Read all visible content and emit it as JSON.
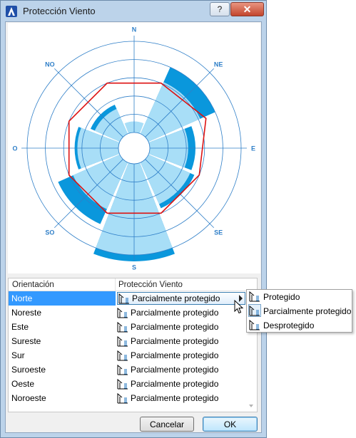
{
  "window": {
    "title": "Protección Viento",
    "help_label": "?",
    "close_label": "✕"
  },
  "rose": {
    "directions": [
      "N",
      "NE",
      "E",
      "SE",
      "S",
      "SO",
      "O",
      "NO"
    ],
    "ring_color": "#2f7fc8",
    "light_color": "#a8def7",
    "dark_color": "#0a97dc",
    "polygon_color": "#dd1111",
    "light_levels": [
      0.12,
      0.62,
      0.42,
      0.5,
      1.0,
      0.56,
      0.45,
      0.3
    ],
    "dark_levels": [
      0.0,
      0.8,
      0.5,
      0.55,
      1.07,
      0.74,
      0.48,
      0.35
    ],
    "polygon_levels": [
      0.6,
      0.68,
      0.6,
      0.6,
      0.6,
      0.6,
      0.6,
      0.6
    ]
  },
  "table": {
    "headers": {
      "orientation": "Orientación",
      "protection": "Protección Viento"
    },
    "rows": [
      {
        "orientation": "Norte",
        "protection": "Parcialmente protegido",
        "selected": true
      },
      {
        "orientation": "Noreste",
        "protection": "Parcialmente protegido"
      },
      {
        "orientation": "Este",
        "protection": "Parcialmente protegido"
      },
      {
        "orientation": "Sureste",
        "protection": "Parcialmente protegido"
      },
      {
        "orientation": "Sur",
        "protection": "Parcialmente protegido"
      },
      {
        "orientation": "Suroeste",
        "protection": "Parcialmente protegido"
      },
      {
        "orientation": "Oeste",
        "protection": "Parcialmente protegido"
      },
      {
        "orientation": "Noroeste",
        "protection": "Parcialmente protegido"
      }
    ]
  },
  "popup": {
    "items": [
      {
        "label": "Protegido"
      },
      {
        "label": "Parcialmente protegido",
        "checked": true
      },
      {
        "label": "Desprotegido"
      }
    ]
  },
  "buttons": {
    "cancel": "Cancelar",
    "ok": "OK"
  }
}
